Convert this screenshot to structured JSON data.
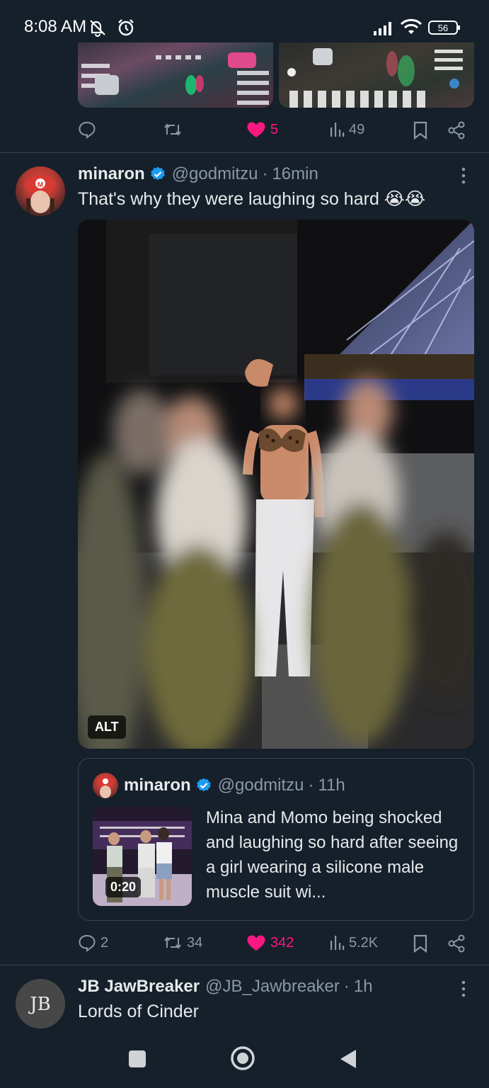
{
  "status_bar": {
    "time": "8:08 AM",
    "battery": "56",
    "icons": [
      "mute-vibrate-icon",
      "alarm-icon",
      "signal-icon",
      "wifi-icon",
      "battery-icon"
    ]
  },
  "prev_tweet": {
    "actions": {
      "replies": "",
      "retweets": "",
      "likes": "5",
      "views": "49"
    }
  },
  "tweet": {
    "name": "minaron",
    "handle": "@godmitzu",
    "separator": "·",
    "time": "16min",
    "text": "That's why they were laughing so hard 😭😭",
    "media_alt_label": "ALT",
    "quote": {
      "name": "minaron",
      "handle": "@godmitzu",
      "separator": "·",
      "time": "11h",
      "text": "Mina and Momo being shocked and laughing so hard after seeing a girl wearing a silicone male muscle suit wi...",
      "video_duration": "0:20"
    },
    "actions": {
      "replies": "2",
      "retweets": "34",
      "likes": "342",
      "views": "5.2K"
    }
  },
  "next_tweet": {
    "name": "JB JawBreaker",
    "handle": "@JB_Jawbreaker",
    "separator": "·",
    "time": "1h",
    "text": "Lords of Cinder",
    "avatar_letters": "JB"
  },
  "colors": {
    "background": "#15202b",
    "like_pink": "#f91880",
    "muted": "#8b98a5",
    "verified_blue": "#1d9bf0",
    "divider": "#38444d"
  }
}
